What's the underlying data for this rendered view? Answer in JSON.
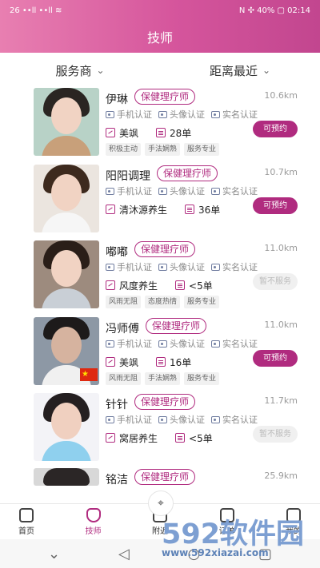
{
  "statusbar": {
    "left": "26 ••ll ••ll ≋",
    "right": "N ✣ 40% ▢ 02:14"
  },
  "header": {
    "title": "技师"
  },
  "filters": [
    {
      "label": "服务商",
      "icon": "chevron-down-icon"
    },
    {
      "label": "距离最近",
      "icon": "chevron-down-icon"
    }
  ],
  "items": [
    {
      "name": "伊琳",
      "tag": "保健理疗师",
      "distance": "10.6km",
      "certs": [
        "手机认证",
        "头像认证",
        "实名认证"
      ],
      "store": "美飒",
      "orders": "28单",
      "action": "可预约",
      "available": true,
      "chips": [
        "积极主动",
        "手法娴熟",
        "服务专业"
      ],
      "flag": false
    },
    {
      "name": "阳阳调理",
      "tag": "保健理疗师",
      "distance": "10.7km",
      "certs": [
        "手机认证",
        "头像认证",
        "实名认证"
      ],
      "store": "清沐源养生",
      "orders": "36单",
      "action": "可预约",
      "available": true,
      "chips": [],
      "flag": false
    },
    {
      "name": "嘟嘟",
      "tag": "保健理疗师",
      "distance": "11.0km",
      "certs": [
        "手机认证",
        "头像认证",
        "实名认证"
      ],
      "store": "风度养生",
      "orders": "<5单",
      "action": "暂不服务",
      "available": false,
      "chips": [
        "风雨无阻",
        "态度热情",
        "服务专业"
      ],
      "flag": false
    },
    {
      "name": "冯师傅",
      "tag": "保健理疗师",
      "distance": "11.0km",
      "certs": [
        "手机认证",
        "头像认证",
        "实名认证"
      ],
      "store": "美飒",
      "orders": "16单",
      "action": "可预约",
      "available": true,
      "chips": [
        "风雨无阻",
        "手法娴熟",
        "服务专业"
      ],
      "flag": true
    },
    {
      "name": "针针",
      "tag": "保健理疗师",
      "distance": "11.7km",
      "certs": [
        "手机认证",
        "头像认证",
        "实名认证"
      ],
      "store": "窝居养生",
      "orders": "<5单",
      "action": "暂不服务",
      "available": false,
      "chips": [],
      "flag": false
    },
    {
      "name": "铭洁",
      "tag": "保健理疗师",
      "distance": "25.9km",
      "certs": [],
      "store": "",
      "orders": "",
      "action": "",
      "available": true,
      "chips": [],
      "flag": false
    }
  ],
  "tabs": [
    {
      "label": "首页",
      "icon": "home-icon",
      "active": false
    },
    {
      "label": "技师",
      "icon": "technician-icon",
      "active": true
    },
    {
      "label": "附近",
      "icon": "location-icon",
      "active": false
    },
    {
      "label": "订单",
      "icon": "order-icon",
      "active": false
    },
    {
      "label": "我的",
      "icon": "user-icon",
      "active": false
    }
  ],
  "nav": {
    "back": "◁",
    "home": "○",
    "recent": "▢",
    "down": "⌄"
  },
  "watermark": {
    "big": "592软件园",
    "small": "www.592xiazai.com"
  }
}
